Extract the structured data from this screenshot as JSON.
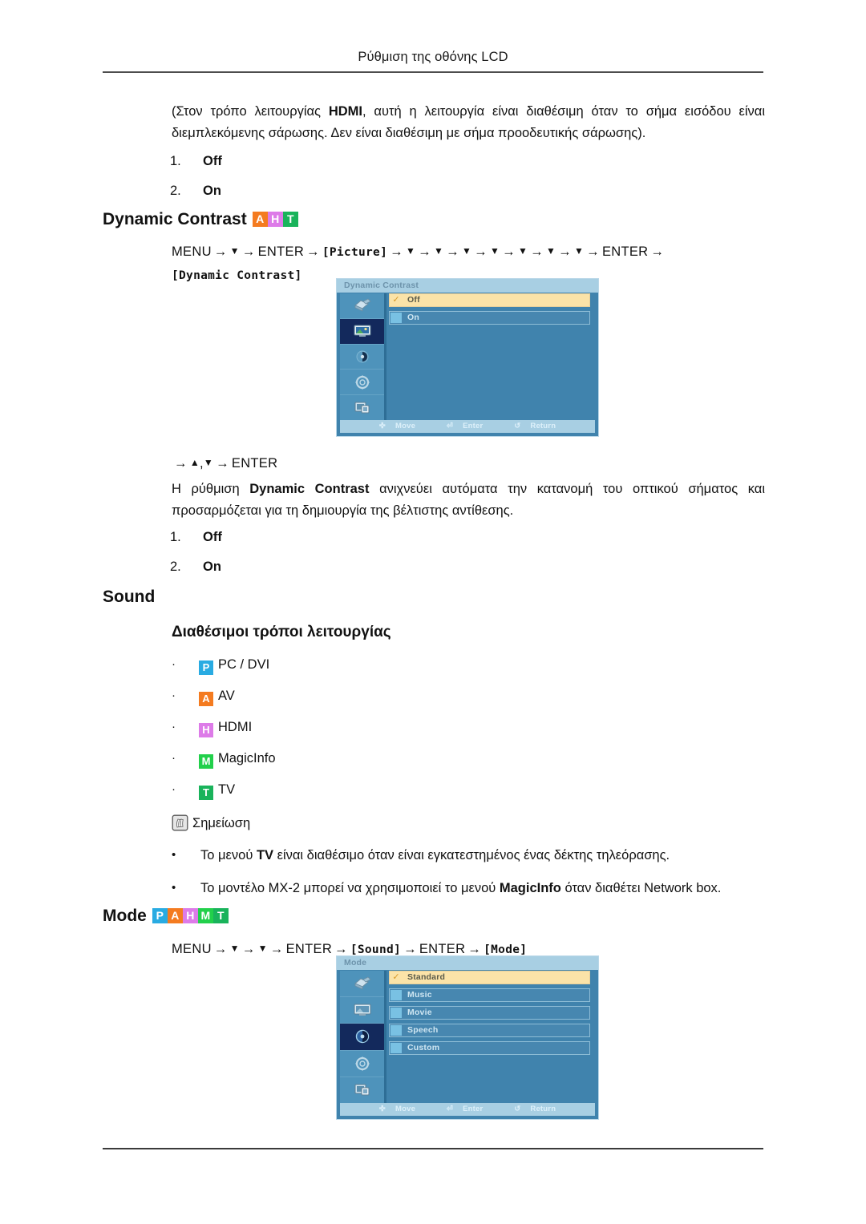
{
  "header": {
    "title": "Ρύθμιση της οθόνης LCD"
  },
  "intro": {
    "paragraph_pre": "(Στον τρόπο λειτουργίας ",
    "paragraph_bold": "HDMI",
    "paragraph_post": ", αυτή η λειτουργία είναι διαθέσιμη όταν το σήμα εισόδου είναι διεμπλεκόμενης σάρωσης. Δεν είναι διαθέσιμη με σήμα προοδευτικής σάρωσης).",
    "options": [
      {
        "index": "1.",
        "value": "Off"
      },
      {
        "index": "2.",
        "value": "On"
      }
    ]
  },
  "dynamic_contrast": {
    "heading": "Dynamic Contrast",
    "badges": [
      "A",
      "H",
      "T"
    ],
    "menu_path": {
      "menu": "MENU",
      "enter": "ENTER",
      "picture": "[Picture]",
      "target": "[Dynamic Contrast]",
      "down_arrow": "▼",
      "up_arrow": "▲",
      "right_arrow": "→"
    },
    "enter_line": {
      "arrow": "→",
      "up": "▲",
      "comma": ",",
      "down": "▼",
      "enter": "ENTER"
    },
    "description_pre": "Η ρύθμιση ",
    "description_bold": "Dynamic Contrast",
    "description_post": " ανιχνεύει αυτόματα την κατανομή του οπτικού σήματος και προσαρμόζεται για τη δημιουργία της βέλτιστης αντίθεσης.",
    "options": [
      {
        "index": "1.",
        "value": "Off"
      },
      {
        "index": "2.",
        "value": "On"
      }
    ],
    "osd": {
      "title": "Dynamic Contrast",
      "items": [
        {
          "label": "Off",
          "selected": true
        },
        {
          "label": "On",
          "selected": false
        }
      ],
      "active_sidebar_index": 1,
      "footer": {
        "move": "Move",
        "enter": "Enter",
        "return": "Return"
      }
    }
  },
  "sound": {
    "heading": "Sound",
    "subheading": "Διαθέσιμοι τρόποι λειτουργίας",
    "modes": [
      {
        "badge": "P",
        "badge_class": "p",
        "label": "PC / DVI"
      },
      {
        "badge": "A",
        "badge_class": "a",
        "label": "AV"
      },
      {
        "badge": "H",
        "badge_class": "h",
        "label": "HDMI"
      },
      {
        "badge": "M",
        "badge_class": "m",
        "label": "MagicInfo"
      },
      {
        "badge": "T",
        "badge_class": "t",
        "label": "TV"
      }
    ],
    "note": {
      "title": "Σημείωση",
      "items": [
        {
          "pre": "Το μενού ",
          "bold": "TV",
          "post": " είναι διαθέσιμο όταν είναι εγκατεστημένος ένας δέκτης τηλεόρασης."
        },
        {
          "pre": "Το μοντέλο ΜΧ-2 μπορεί να χρησιμοποιεί το μενού ",
          "bold": "MagicInfo",
          "post": " όταν διαθέτει Network box."
        }
      ]
    }
  },
  "mode": {
    "heading": "Mode",
    "badges": [
      "P",
      "A",
      "H",
      "M",
      "T"
    ],
    "menu_path": {
      "menu": "MENU",
      "enter": "ENTER",
      "sound": "[Sound]",
      "target": "[Mode]",
      "down_arrow": "▼",
      "right_arrow": "→"
    },
    "osd": {
      "title": "Mode",
      "items": [
        {
          "label": "Standard",
          "selected": true
        },
        {
          "label": "Music",
          "selected": false
        },
        {
          "label": "Movie",
          "selected": false
        },
        {
          "label": "Speech",
          "selected": false
        },
        {
          "label": "Custom",
          "selected": false
        }
      ],
      "active_sidebar_index": 2,
      "footer": {
        "move": "Move",
        "enter": "Enter",
        "return": "Return"
      }
    }
  },
  "colors": {
    "badge_pc": "#29ABE2",
    "badge_av": "#F47B20",
    "badge_hdmi": "#DD7BE8",
    "badge_magicinfo": "#22D04B",
    "badge_tv": "#19B35B",
    "osd_background": "#4083AD",
    "osd_highlight": "#FBE3A8"
  }
}
